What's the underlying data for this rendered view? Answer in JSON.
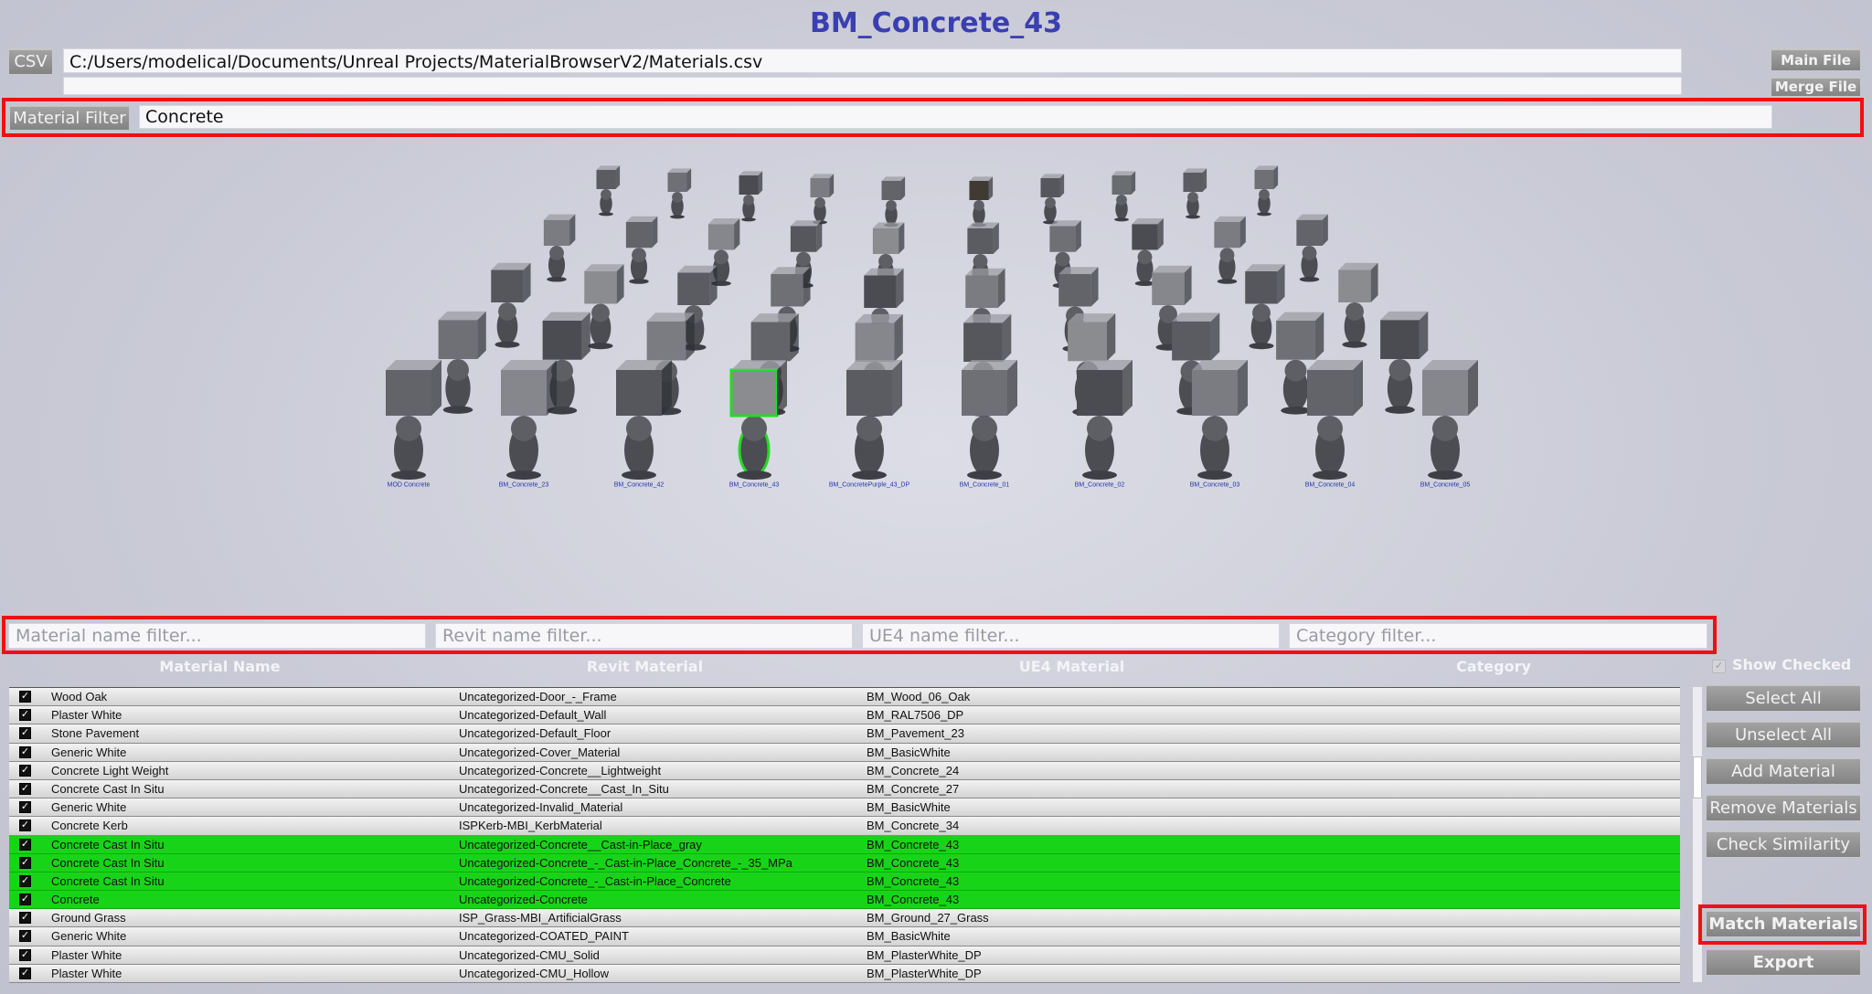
{
  "title": "BM_Concrete_43",
  "csv_button": "CSV",
  "csv_path": "C:/Users/modelical/Documents/Unreal Projects/MaterialBrowserV2/Materials.csv",
  "merge_path": "",
  "main_file_button": "Main File",
  "merge_file_button": "Merge File",
  "material_filter": {
    "label": "Material Filter",
    "value": "Concrete"
  },
  "viewport_labels": [
    "MOD Concrete",
    "BM_Concrete_23",
    "BM_Concrete_42",
    "BM_Concrete_43",
    "BM_ConcretePurple_43_DP",
    "BM_Concrete_01",
    "BM_Concrete_02",
    "BM_Concrete_03",
    "BM_Concrete_04",
    "BM_Concrete_05"
  ],
  "filters": {
    "material_name": "Material name filter...",
    "revit_name": "Revit name filter...",
    "ue4_name": "UE4 name filter...",
    "category": "Category filter..."
  },
  "columns": [
    "Material Name",
    "Revit Material",
    "UE4 Material",
    "Category"
  ],
  "show_checked": "Show Checked",
  "rows": [
    {
      "name": "Wood Oak",
      "revit": "Uncategorized-Door_-_Frame",
      "ue4": "BM_Wood_06_Oak",
      "selected": false
    },
    {
      "name": "Plaster White",
      "revit": "Uncategorized-Default_Wall",
      "ue4": "BM_RAL7506_DP",
      "selected": false
    },
    {
      "name": "Stone Pavement",
      "revit": "Uncategorized-Default_Floor",
      "ue4": "BM_Pavement_23",
      "selected": false
    },
    {
      "name": "Generic White",
      "revit": "Uncategorized-Cover_Material",
      "ue4": "BM_BasicWhite",
      "selected": false
    },
    {
      "name": "Concrete Light Weight",
      "revit": "Uncategorized-Concrete__Lightweight",
      "ue4": "BM_Concrete_24",
      "selected": false
    },
    {
      "name": "Concrete Cast In Situ",
      "revit": "Uncategorized-Concrete__Cast_In_Situ",
      "ue4": "BM_Concrete_27",
      "selected": false
    },
    {
      "name": "Generic White",
      "revit": "Uncategorized-Invalid_Material",
      "ue4": "BM_BasicWhite",
      "selected": false
    },
    {
      "name": "Concrete Kerb",
      "revit": "ISPKerb-MBI_KerbMaterial",
      "ue4": "BM_Concrete_34",
      "selected": false
    },
    {
      "name": "Concrete Cast In Situ",
      "revit": "Uncategorized-Concrete__Cast-in-Place_gray",
      "ue4": "BM_Concrete_43",
      "selected": true
    },
    {
      "name": "Concrete Cast In Situ",
      "revit": "Uncategorized-Concrete_-_Cast-in-Place_Concrete_-_35_MPa",
      "ue4": "BM_Concrete_43",
      "selected": true
    },
    {
      "name": "Concrete Cast In Situ",
      "revit": "Uncategorized-Concrete_-_Cast-in-Place_Concrete",
      "ue4": "BM_Concrete_43",
      "selected": true
    },
    {
      "name": "Concrete",
      "revit": "Uncategorized-Concrete",
      "ue4": "BM_Concrete_43",
      "selected": true
    },
    {
      "name": "Ground Grass",
      "revit": "ISP_Grass-MBI_ArtificialGrass",
      "ue4": "BM_Ground_27_Grass",
      "selected": false
    },
    {
      "name": "Generic White",
      "revit": "Uncategorized-COATED_PAINT",
      "ue4": "BM_BasicWhite",
      "selected": false
    },
    {
      "name": "Plaster White",
      "revit": "Uncategorized-CMU_Solid",
      "ue4": "BM_PlasterWhite_DP",
      "selected": false
    },
    {
      "name": "Plaster White",
      "revit": "Uncategorized-CMU_Hollow",
      "ue4": "BM_PlasterWhite_DP",
      "selected": false
    }
  ],
  "buttons": {
    "select_all": "Select All",
    "unselect_all": "Unselect All",
    "add_material": "Add Material",
    "remove_materials": "Remove Materials",
    "check_similarity": "Check Similarity",
    "match_materials": "Match Materials",
    "export": "Export"
  },
  "colors": {
    "title": "#3a3fb0",
    "highlight": "#ee1111",
    "selected_row": "#18d418"
  }
}
